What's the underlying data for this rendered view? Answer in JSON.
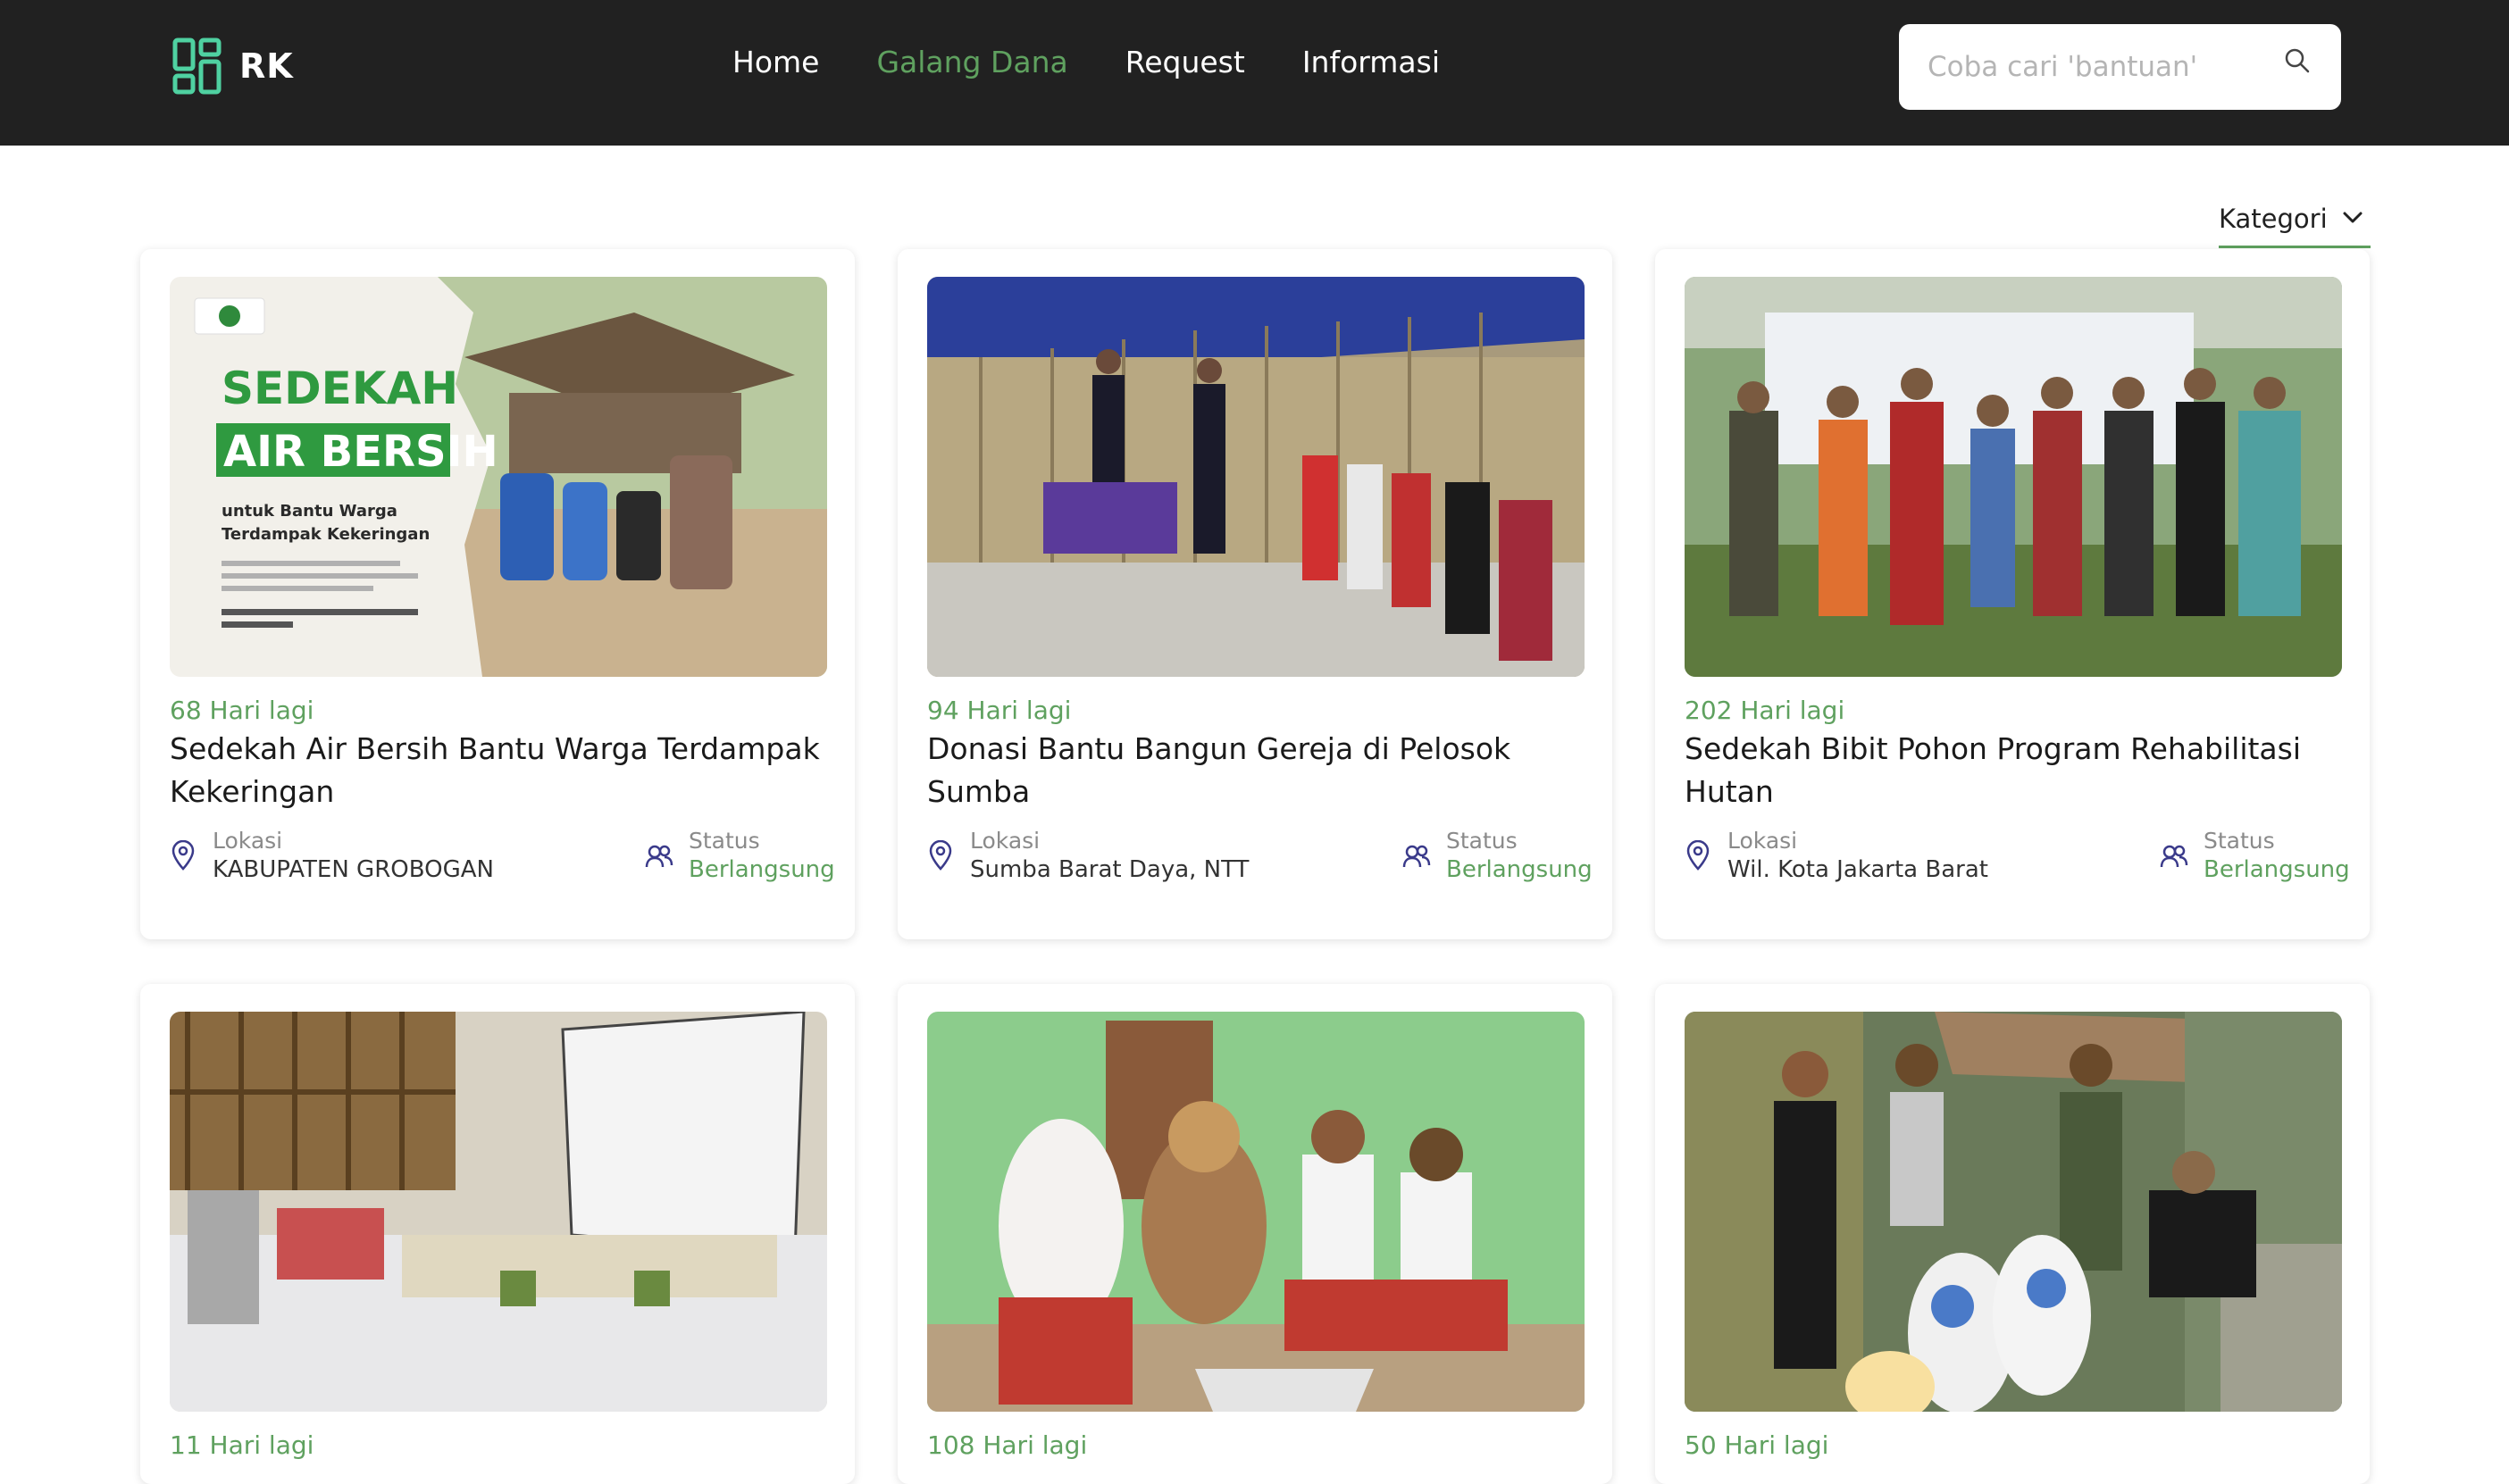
{
  "header": {
    "logo_text": "RK",
    "nav": [
      {
        "label": "Home",
        "active": false
      },
      {
        "label": "Galang Dana",
        "active": true
      },
      {
        "label": "Request",
        "active": false
      },
      {
        "label": "Informasi",
        "active": false
      }
    ],
    "search_placeholder": "Coba cari 'bantuan'"
  },
  "filter": {
    "kategori_label": "Kategori"
  },
  "colors": {
    "accent": "#5fa15f",
    "header_bg": "#212121"
  },
  "cards": [
    {
      "days": "68 Hari lagi",
      "title": "Sedekah Air Bersih Bantu Warga Terdampak Kekeringan",
      "location_label": "Lokasi",
      "location": "KABUPATEN GROBOGAN",
      "status_label": "Status",
      "status": "Berlangsung",
      "image_text": {
        "headline_1": "SEDEKAH",
        "headline_2": "AIR BERSIH",
        "sub": "untuk Bantu Warga Terdampak Kekeringan"
      }
    },
    {
      "days": "94 Hari lagi",
      "title": "Donasi Bantu Bangun Gereja di Pelosok Sumba",
      "location_label": "Lokasi",
      "location": "Sumba Barat Daya, NTT",
      "status_label": "Status",
      "status": "Berlangsung"
    },
    {
      "days": "202 Hari lagi",
      "title": "Sedekah Bibit Pohon Program Rehabilitasi Hutan",
      "location_label": "Lokasi",
      "location": "Wil. Kota Jakarta Barat",
      "status_label": "Status",
      "status": "Berlangsung"
    },
    {
      "days": "11 Hari lagi"
    },
    {
      "days": "108 Hari lagi"
    },
    {
      "days": "50 Hari lagi"
    }
  ]
}
